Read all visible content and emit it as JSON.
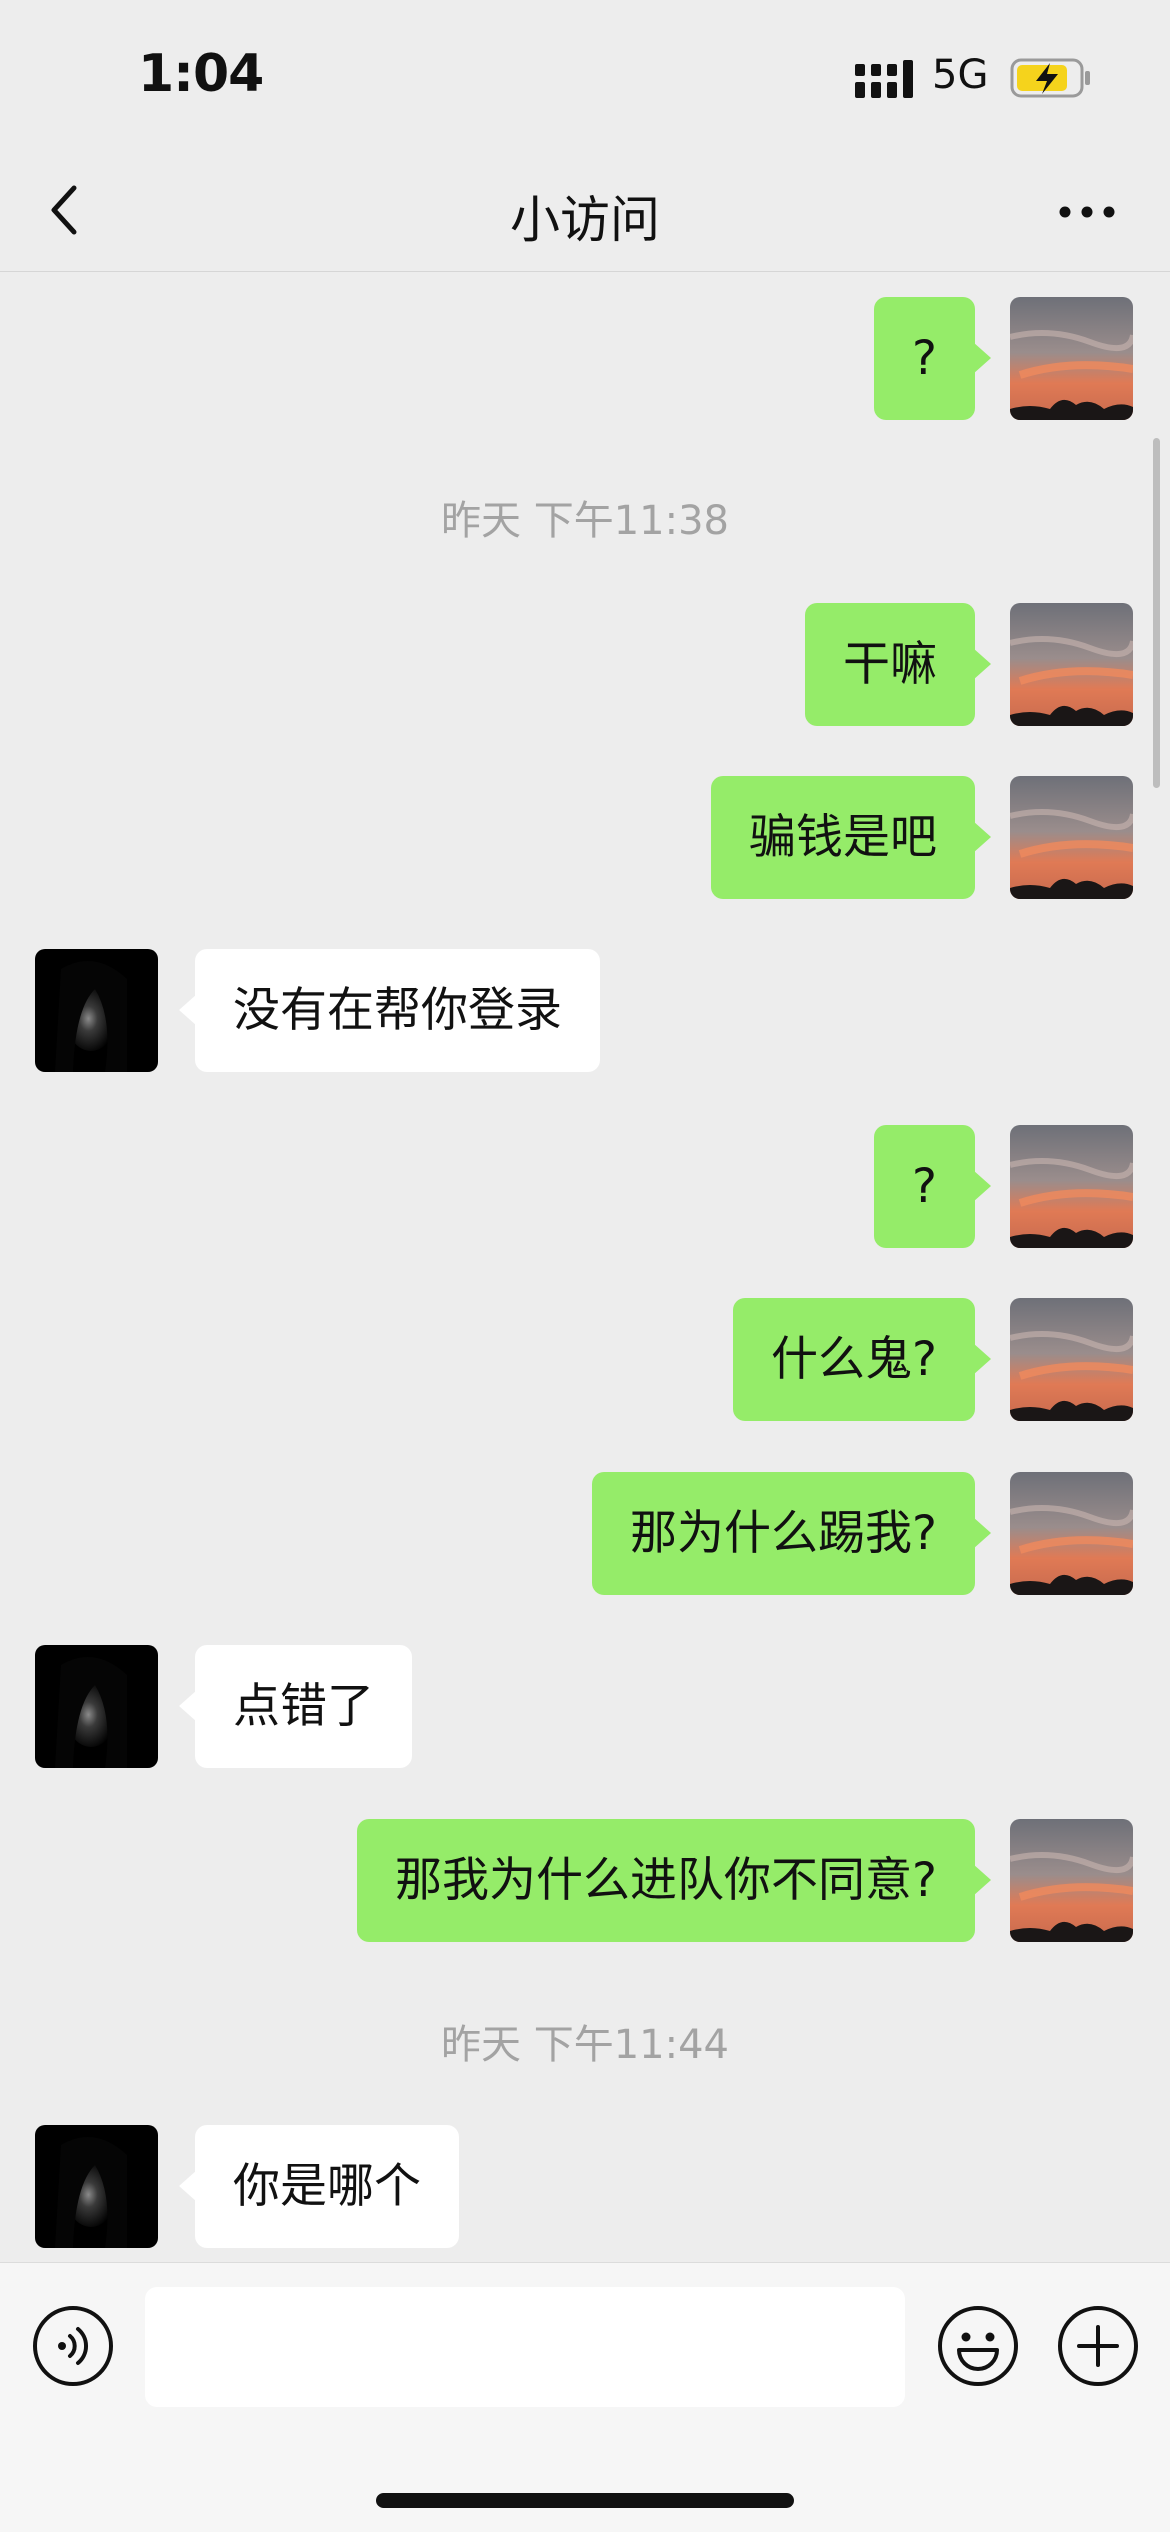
{
  "status_bar": {
    "time": "1:04",
    "network": "5G",
    "battery_charging": true,
    "accent_color": "#F5D31C"
  },
  "nav": {
    "title": "小访问",
    "back_icon": "chevron-left-icon",
    "more_icon": "more-dots-icon"
  },
  "colors": {
    "me_bubble": "#95EC69",
    "other_bubble": "#FFFFFF",
    "background": "#EDEDED"
  },
  "messages": [
    {
      "from": "me",
      "text": "?"
    },
    {
      "type": "timestamp",
      "text": "昨天 下午11:38"
    },
    {
      "from": "me",
      "text": "干嘛"
    },
    {
      "from": "me",
      "text": "骗钱是吧"
    },
    {
      "from": "other",
      "text": "没有在帮你登录"
    },
    {
      "from": "me",
      "text": "?"
    },
    {
      "from": "me",
      "text": "什么鬼?"
    },
    {
      "from": "me",
      "text": "那为什么踢我?"
    },
    {
      "from": "other",
      "text": "点错了"
    },
    {
      "from": "me",
      "text": "那我为什么进队你不同意?"
    },
    {
      "type": "timestamp",
      "text": "昨天 下午11:44"
    },
    {
      "from": "other",
      "text": "你是哪个"
    }
  ],
  "input": {
    "value": "",
    "placeholder": ""
  }
}
